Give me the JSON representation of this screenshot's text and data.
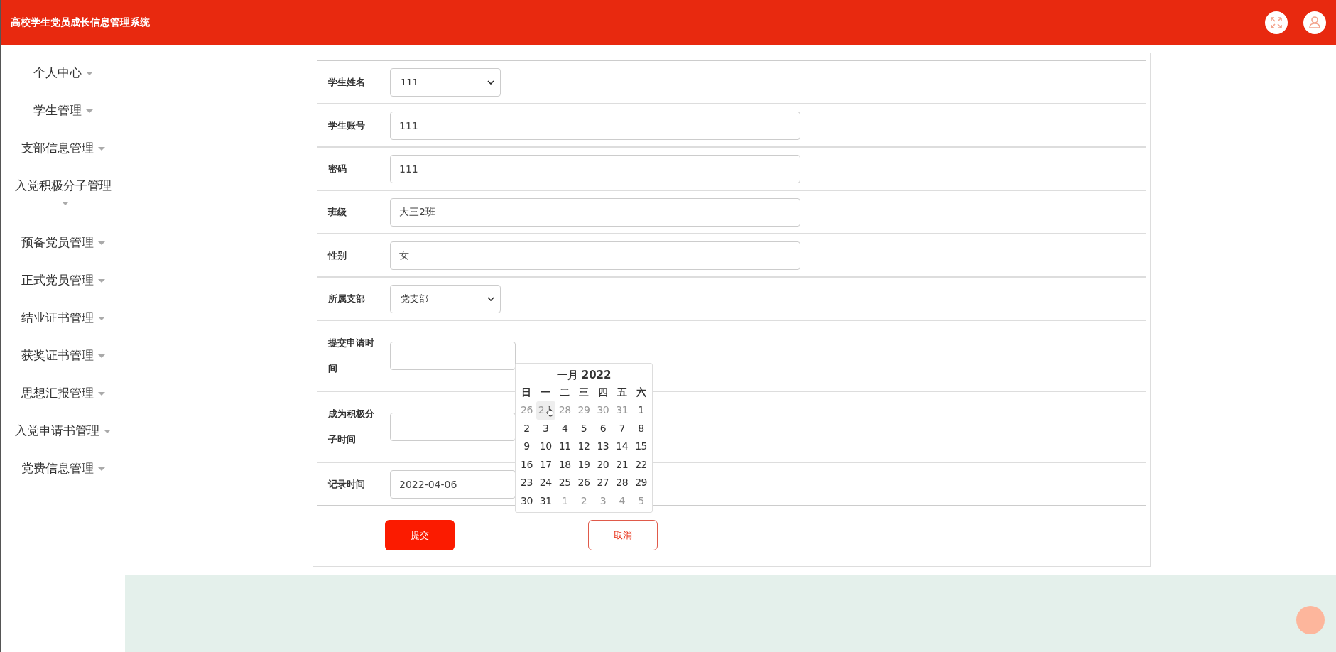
{
  "header": {
    "title": "高校学生党员成长信息管理系统"
  },
  "sidebar": {
    "items": [
      {
        "label": "个人中心"
      },
      {
        "label": "学生管理"
      },
      {
        "label": "支部信息管理"
      },
      {
        "label": "入党积极分子管理"
      },
      {
        "label": "预备党员管理"
      },
      {
        "label": "正式党员管理"
      },
      {
        "label": "结业证书管理"
      },
      {
        "label": "获奖证书管理"
      },
      {
        "label": "思想汇报管理"
      },
      {
        "label": "入党申请书管理"
      },
      {
        "label": "党费信息管理"
      }
    ]
  },
  "form": {
    "fields": [
      {
        "label": "学生姓名",
        "kind": "select",
        "value": "111"
      },
      {
        "label": "学生账号",
        "kind": "text",
        "value": "111"
      },
      {
        "label": "密码",
        "kind": "text",
        "value": "111"
      },
      {
        "label": "班级",
        "kind": "text",
        "value": "大三2班"
      },
      {
        "label": "性别",
        "kind": "text",
        "value": "女"
      },
      {
        "label": "所属支部",
        "kind": "select",
        "value": "党支部"
      },
      {
        "label": "提交申请时间",
        "kind": "date"
      },
      {
        "label": "成为积极分子时间",
        "kind": "date"
      },
      {
        "label": "记录时间",
        "kind": "date",
        "value": "2022-04-06"
      }
    ],
    "buttons": [
      {
        "label": "提交",
        "kind": "primary"
      },
      {
        "label": "取消",
        "kind": "secondary"
      }
    ]
  },
  "datepicker": {
    "title": "一月 2022",
    "weekdays": [
      "日",
      "一",
      "二",
      "三",
      "四",
      "五",
      "六"
    ],
    "days": [
      {
        "label": "26",
        "kind": "other",
        "hovered": false
      },
      {
        "label": "2",
        "kind": "other",
        "hovered": true
      },
      {
        "label": "28",
        "kind": "other",
        "hovered": false
      },
      {
        "label": "29",
        "kind": "other",
        "hovered": false
      },
      {
        "label": "30",
        "kind": "other",
        "hovered": false
      },
      {
        "label": "31",
        "kind": "other",
        "hovered": false
      },
      {
        "label": "1",
        "kind": "current",
        "hovered": false
      },
      {
        "label": "2",
        "kind": "current",
        "hovered": false
      },
      {
        "label": "3",
        "kind": "current",
        "hovered": false
      },
      {
        "label": "4",
        "kind": "current",
        "hovered": false
      },
      {
        "label": "5",
        "kind": "current",
        "hovered": false
      },
      {
        "label": "6",
        "kind": "current",
        "hovered": false
      },
      {
        "label": "7",
        "kind": "current",
        "hovered": false
      },
      {
        "label": "8",
        "kind": "current",
        "hovered": false
      },
      {
        "label": "9",
        "kind": "current",
        "hovered": false
      },
      {
        "label": "10",
        "kind": "current",
        "hovered": false
      },
      {
        "label": "11",
        "kind": "current",
        "hovered": false
      },
      {
        "label": "12",
        "kind": "current",
        "hovered": false
      },
      {
        "label": "13",
        "kind": "current",
        "hovered": false
      },
      {
        "label": "14",
        "kind": "current",
        "hovered": false
      },
      {
        "label": "15",
        "kind": "current",
        "hovered": false
      },
      {
        "label": "16",
        "kind": "current",
        "hovered": false
      },
      {
        "label": "17",
        "kind": "current",
        "hovered": false
      },
      {
        "label": "18",
        "kind": "current",
        "hovered": false
      },
      {
        "label": "19",
        "kind": "current",
        "hovered": false
      },
      {
        "label": "20",
        "kind": "current",
        "hovered": false
      },
      {
        "label": "21",
        "kind": "current",
        "hovered": false
      },
      {
        "label": "22",
        "kind": "current",
        "hovered": false
      },
      {
        "label": "23",
        "kind": "current",
        "hovered": false
      },
      {
        "label": "24",
        "kind": "current",
        "hovered": false
      },
      {
        "label": "25",
        "kind": "current",
        "hovered": false
      },
      {
        "label": "26",
        "kind": "current",
        "hovered": false
      },
      {
        "label": "27",
        "kind": "current",
        "hovered": false
      },
      {
        "label": "28",
        "kind": "current",
        "hovered": false
      },
      {
        "label": "29",
        "kind": "current",
        "hovered": false
      },
      {
        "label": "30",
        "kind": "current",
        "hovered": false
      },
      {
        "label": "31",
        "kind": "current",
        "hovered": false
      },
      {
        "label": "1",
        "kind": "other",
        "hovered": false
      },
      {
        "label": "2",
        "kind": "other",
        "hovered": false
      },
      {
        "label": "3",
        "kind": "other",
        "hovered": false
      },
      {
        "label": "4",
        "kind": "other",
        "hovered": false
      },
      {
        "label": "5",
        "kind": "other",
        "hovered": false
      }
    ]
  }
}
